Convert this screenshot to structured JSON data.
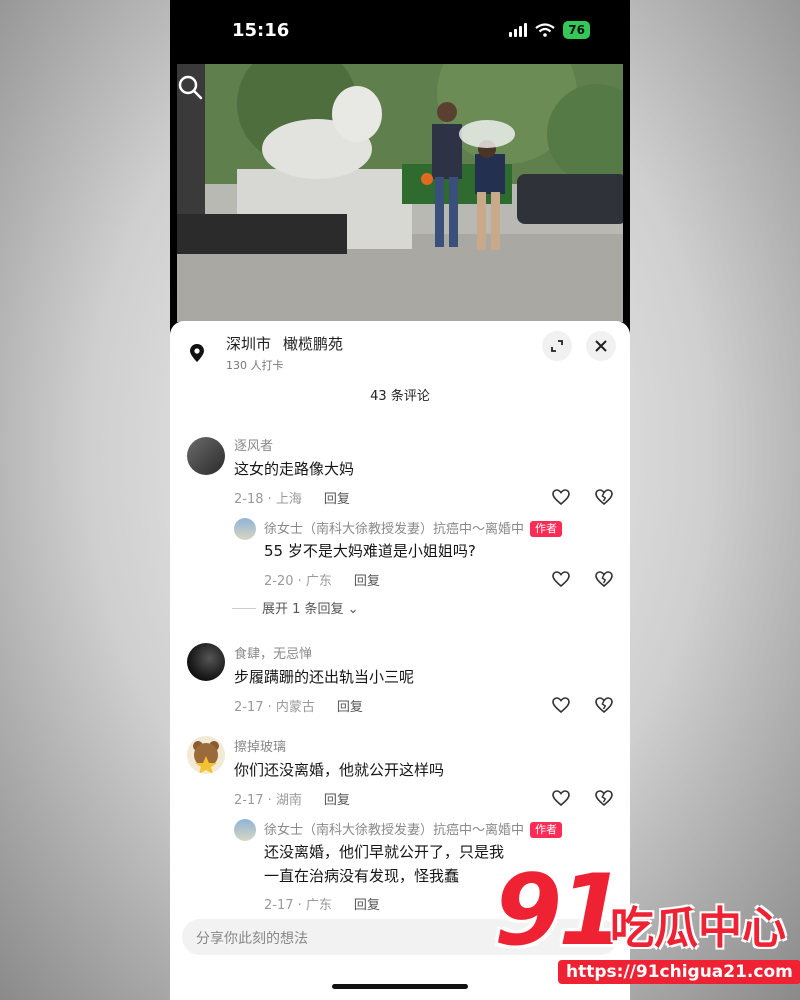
{
  "status_bar": {
    "time": "15:16",
    "battery": "76"
  },
  "location": {
    "city": "深圳市",
    "place": "橄榄鹏苑",
    "checkins": "130 人打卡"
  },
  "comments_count": "43 条评论",
  "comments": [
    {
      "user": "逐风者",
      "text": "这女的走路像大妈",
      "date_region": "2-18 · 上海",
      "reply_label": "回复",
      "replies": [
        {
          "user": "徐女士（南科大徐教授发妻）抗癌中～离婚中",
          "tag": "作者",
          "text": "55 岁不是大妈难道是小姐姐吗?",
          "date_region": "2-20 · 广东",
          "reply_label": "回复"
        }
      ],
      "expand_label": "展开 1 条回复"
    },
    {
      "user": "食肆，无忌惮",
      "text": "步履蹒跚的还出轨当小三呢",
      "date_region": "2-17 · 内蒙古",
      "reply_label": "回复"
    },
    {
      "user": "擦掉玻璃",
      "text": "你们还没离婚，他就公开这样吗",
      "date_region": "2-17 · 湖南",
      "reply_label": "回复",
      "replies": [
        {
          "user": "徐女士（南科大徐教授发妻）抗癌中～离婚中",
          "tag": "作者",
          "text": "还没离婚，他们早就公开了，只是我一直在治病没有发现，怪我蠢",
          "date_region": "2-17 · 广东",
          "reply_label": "回复"
        }
      ]
    }
  ],
  "input": {
    "placeholder": "分享你此刻的想法"
  },
  "watermark": {
    "number": "91",
    "brand": "吃瓜中心",
    "url": "https://91chigua21.com"
  },
  "colors": {
    "accent": "#fe2c55",
    "battery": "#34c759",
    "watermark": "#ee2233"
  }
}
